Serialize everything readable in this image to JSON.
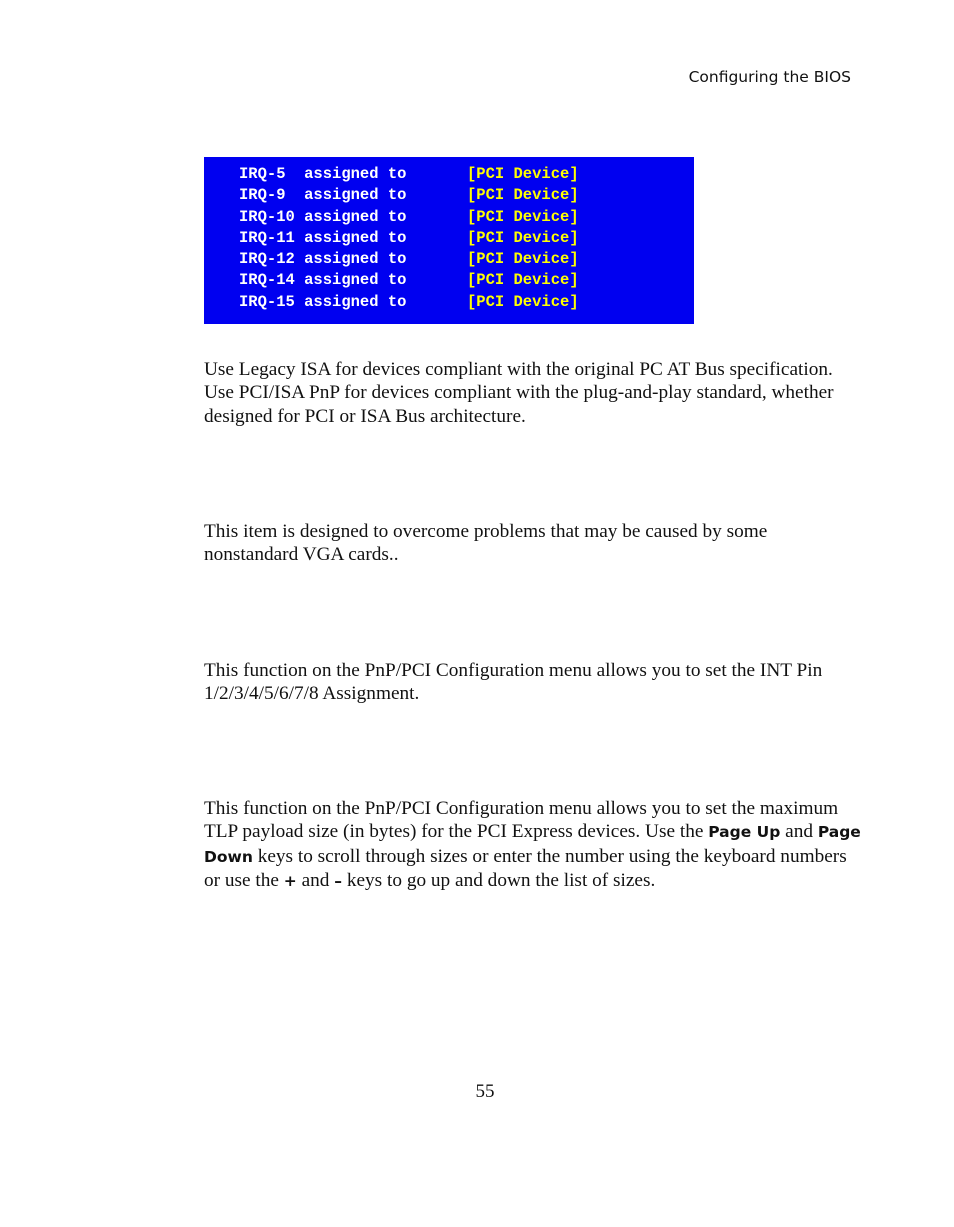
{
  "header": {
    "section_title": "Configuring the BIOS"
  },
  "bios_screen": {
    "background_color": "#0000f0",
    "label_color": "#ffffff",
    "value_color": "#ffff00",
    "rows": [
      {
        "label": "IRQ-5  assigned to",
        "value": "[PCI Device]"
      },
      {
        "label": "IRQ-9  assigned to",
        "value": "[PCI Device]"
      },
      {
        "label": "IRQ-10 assigned to",
        "value": "[PCI Device]"
      },
      {
        "label": "IRQ-11 assigned to",
        "value": "[PCI Device]"
      },
      {
        "label": "IRQ-12 assigned to",
        "value": "[PCI Device]"
      },
      {
        "label": "IRQ-14 assigned to",
        "value": "[PCI Device]"
      },
      {
        "label": "IRQ-15 assigned to",
        "value": "[PCI Device]"
      }
    ]
  },
  "paragraphs": {
    "irq_assignment": "Use Legacy ISA for devices compliant with the original PC AT Bus specification. Use PCI/ISA PnP for devices compliant with the plug-and-play standard, whether designed for PCI or ISA Bus architecture.",
    "vga_palette": "This item is designed to overcome problems that may be caused by some nonstandard VGA cards..",
    "int_pin": "This function on the PnP/PCI Configuration menu allows you to set the INT Pin 1/2/3/4/5/6/7/8 Assignment.",
    "tlp_payload": {
      "part1": "This function on the PnP/PCI Configuration menu allows you to set the maximum TLP payload size (in bytes) for the PCI Express devices. Use the ",
      "key_page_up": "Page Up",
      "part2": " and ",
      "key_page_down": "Page Down",
      "part3": " keys to scroll through sizes or enter the number using the keyboard numbers or use the ",
      "key_plus": "+",
      "part4": " and ",
      "key_minus": "–",
      "part5": " keys to go up and down the list of sizes."
    }
  },
  "footer": {
    "page_number": "55"
  }
}
